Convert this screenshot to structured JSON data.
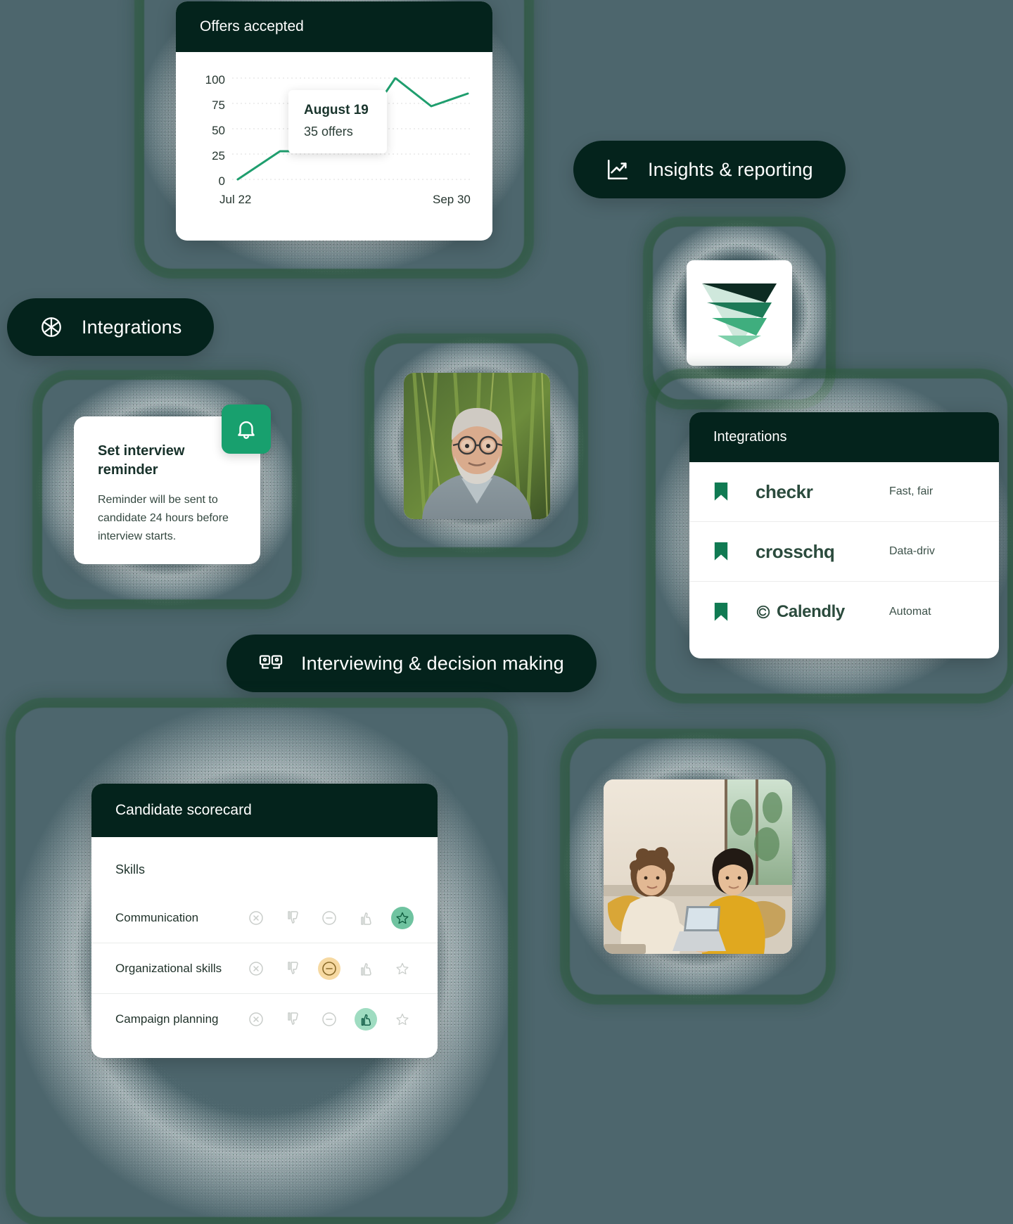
{
  "background_color": "#4d666d",
  "dark_green": "#04231c",
  "accent_green": "#18a06e",
  "pills": [
    {
      "id": "insights",
      "label": "Insights & reporting",
      "icon": "trending-up-icon"
    },
    {
      "id": "integrations",
      "label": "Integrations",
      "icon": "integrations-hub-icon"
    },
    {
      "id": "interviewing",
      "label": "Interviewing & decision making",
      "icon": "interview-cards-icon"
    }
  ],
  "offers_card": {
    "title": "Offers accepted",
    "tooltip": {
      "date": "August 19",
      "value": "35 offers"
    }
  },
  "chart_data": {
    "type": "line",
    "title": "Offers accepted",
    "xlabel": "",
    "ylabel": "",
    "ylim": [
      0,
      100
    ],
    "yticks": [
      0,
      25,
      50,
      75,
      100
    ],
    "ytick_labels": [
      "0",
      "25",
      "50",
      "75",
      "100"
    ],
    "xtick_labels": [
      "Jul 22",
      "Sep 30"
    ],
    "x_start": "Jul 22",
    "x_end": "Sep 30",
    "grid": true,
    "line_color": "#1f9e6e",
    "series": [
      {
        "name": "Offers accepted",
        "x": [
          0,
          1,
          2,
          3,
          4,
          5,
          6,
          7
        ],
        "values": [
          0,
          28,
          28,
          35,
          72,
          100,
          72,
          88
        ]
      }
    ],
    "highlight_point": {
      "x_label": "August 19",
      "value": 35,
      "label": "35 offers"
    }
  },
  "reminder_card": {
    "title": "Set interview reminder",
    "body": "Reminder will be sent to candidate 24 hours before interview starts.",
    "badge_icon": "bell-icon"
  },
  "integrations_card": {
    "title": "Integrations",
    "rows": [
      {
        "flag": "bookmark-icon",
        "logo": "checkr",
        "desc": "Fast, fair"
      },
      {
        "flag": "bookmark-icon",
        "logo": "crosschq",
        "desc": "Data-driv"
      },
      {
        "flag": "bookmark-icon",
        "logo": "Calendly",
        "desc": "Automat"
      }
    ]
  },
  "scorecard": {
    "title": "Candidate scorecard",
    "section_label": "Skills",
    "rating_icons": [
      "x-circle-icon",
      "thumb-down-icon",
      "minus-circle-icon",
      "thumb-up-icon",
      "star-icon"
    ],
    "rows": [
      {
        "skill": "Communication",
        "selected_index": 4,
        "selected_icon": "star-icon",
        "selected_color": "#6fc3a0"
      },
      {
        "skill": "Organizational skills",
        "selected_index": 2,
        "selected_icon": "minus-circle-icon",
        "selected_color": "#f6d9a2"
      },
      {
        "skill": "Campaign planning",
        "selected_index": 3,
        "selected_icon": "thumb-up-icon",
        "selected_color": "#9fdcc1"
      }
    ]
  },
  "logo_tile": {
    "name": "greenhouse-triangle-logo"
  },
  "photos": [
    {
      "name": "portrait-man-glasses-bamboo"
    },
    {
      "name": "two-women-laptop-sofa"
    }
  ]
}
